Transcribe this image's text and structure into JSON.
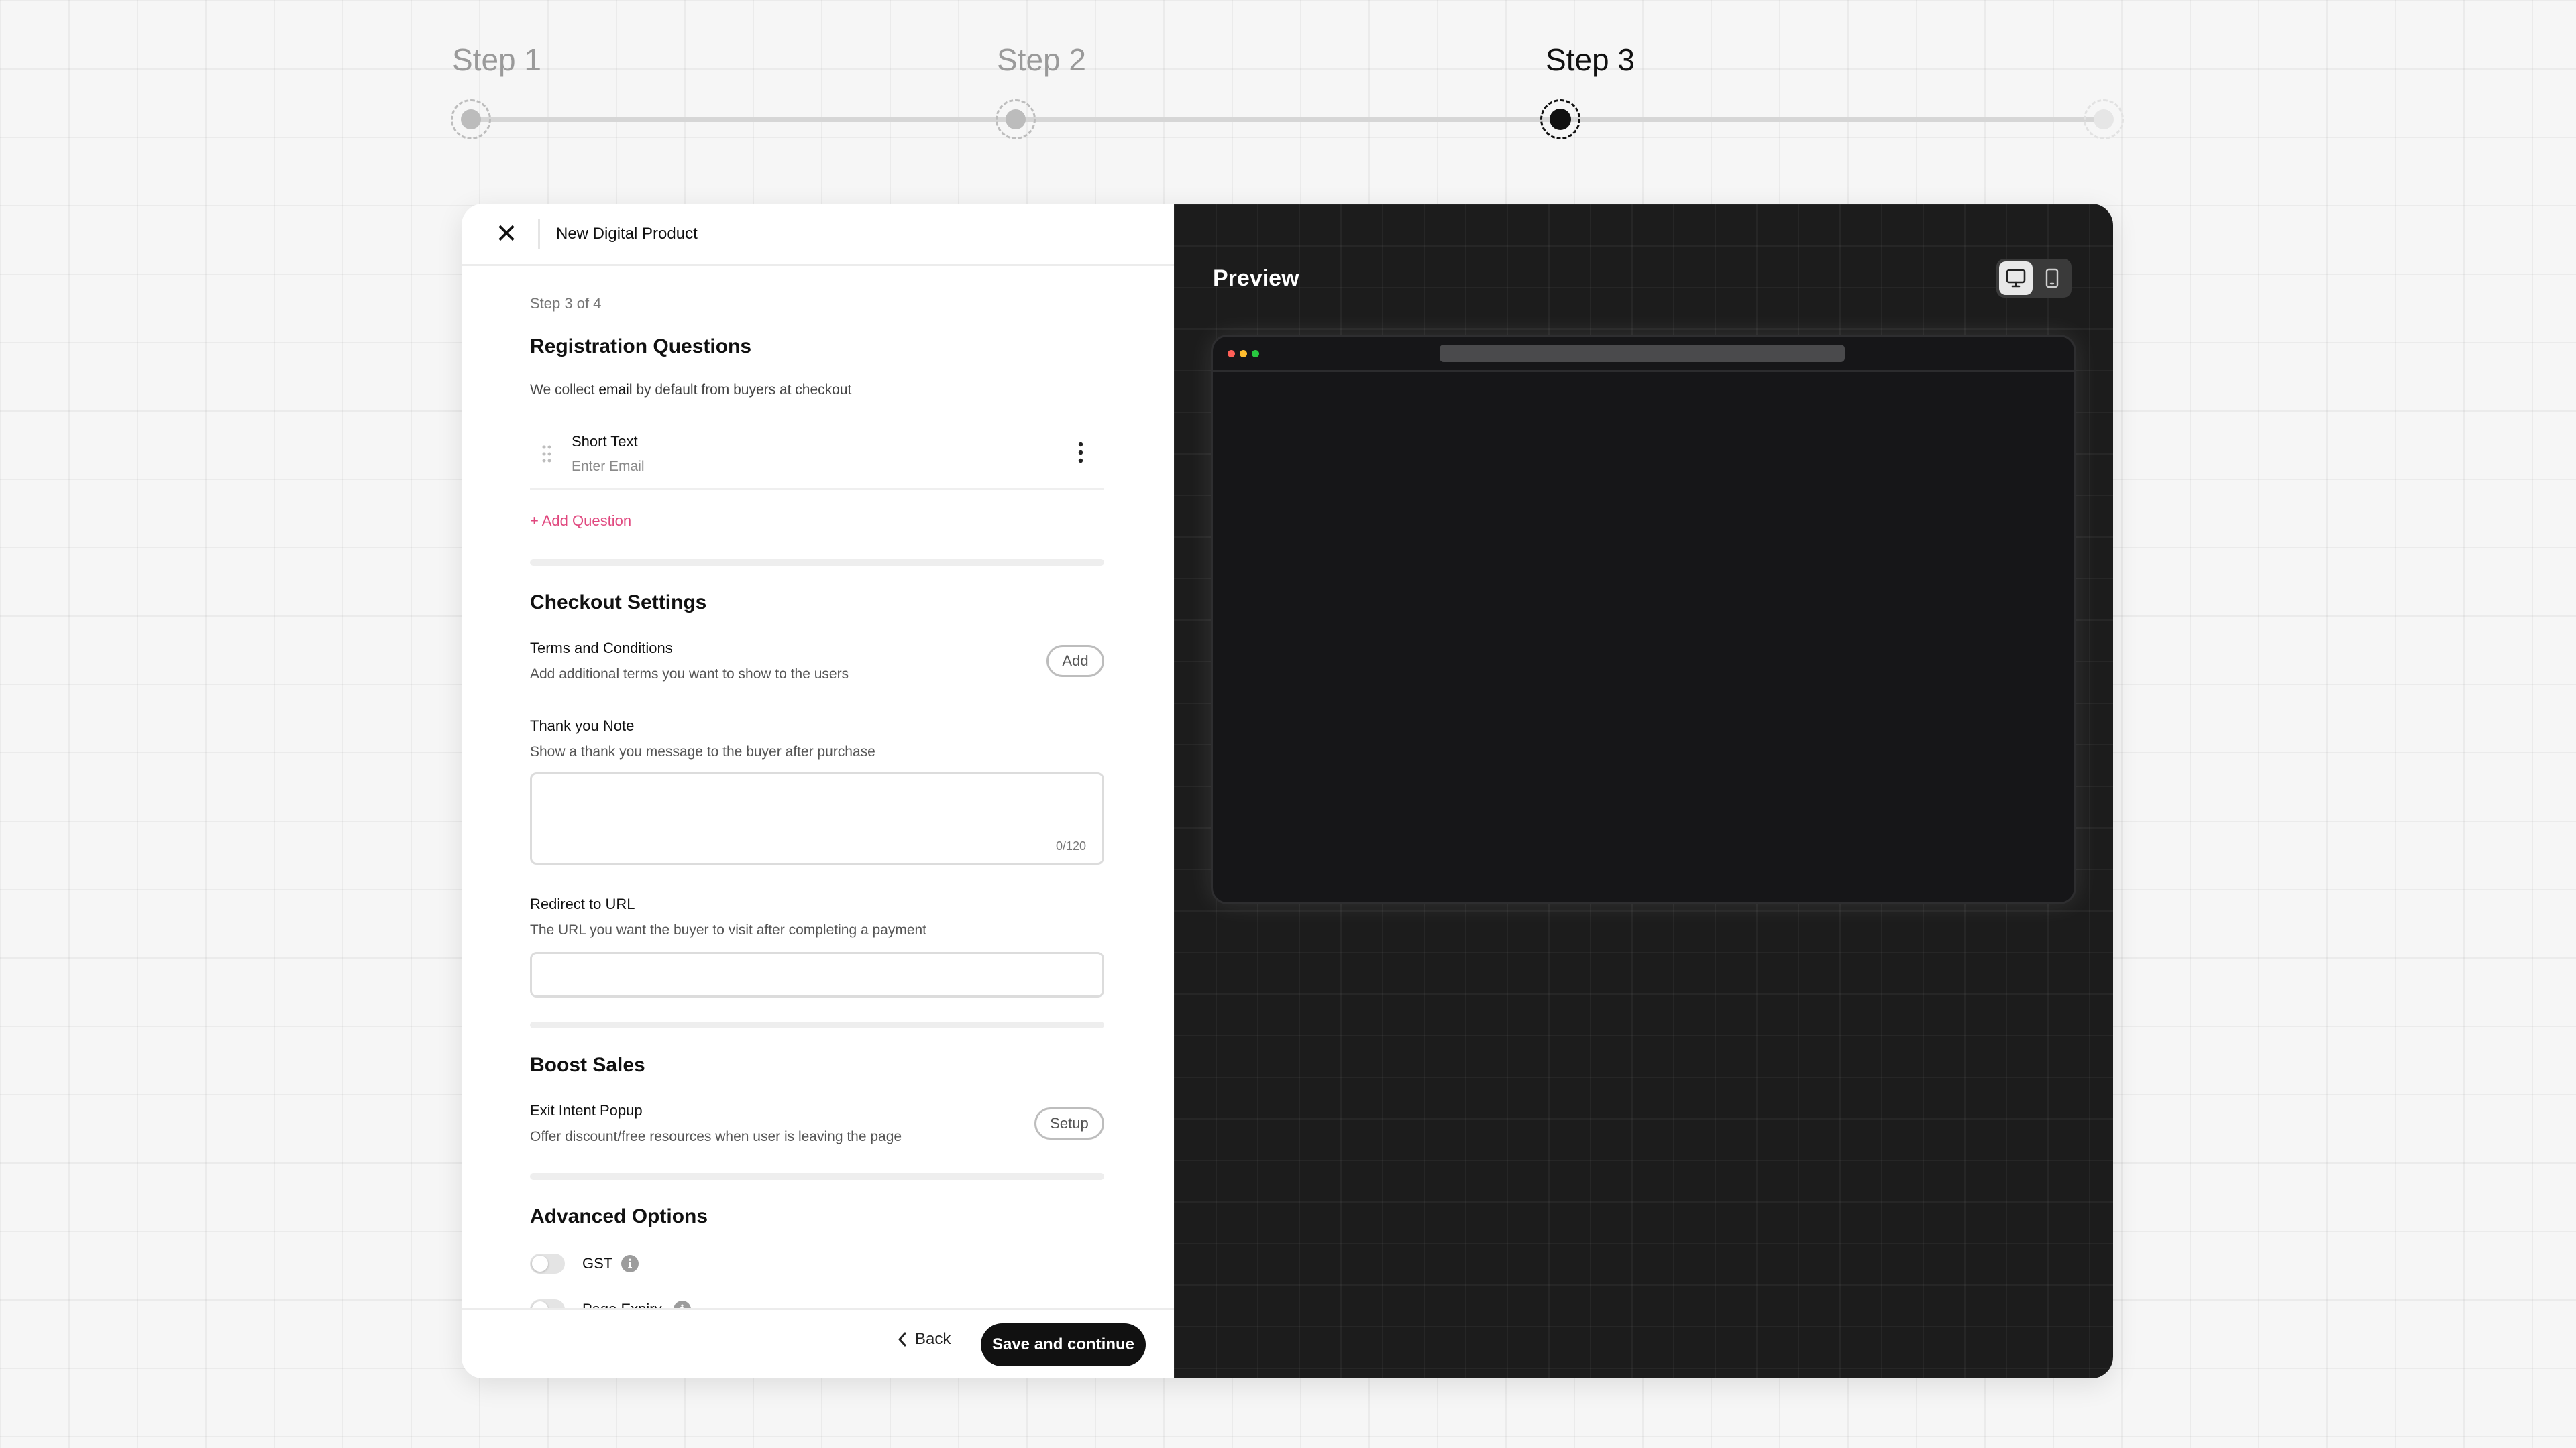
{
  "stepper": {
    "steps": [
      {
        "label": "Step 1",
        "state": "done"
      },
      {
        "label": "Step 2",
        "state": "done"
      },
      {
        "label": "Step 3",
        "state": "active"
      },
      {
        "label": "",
        "state": "future"
      }
    ]
  },
  "header": {
    "close_icon": "close-icon",
    "title": "New Digital Product"
  },
  "form": {
    "step_count": "Step 3 of 4",
    "registration": {
      "title": "Registration Questions",
      "desc_prefix": "We collect ",
      "desc_bold": "email",
      "desc_suffix": " by default from buyers at checkout",
      "question": {
        "type_label": "Short Text",
        "placeholder": "Enter Email",
        "drag_icon": "drag-handle-icon",
        "menu_icon": "more-vertical-icon"
      },
      "add_question_label": "+ Add Question",
      "accent_color": "#e0477e"
    },
    "checkout": {
      "title": "Checkout Settings",
      "terms": {
        "title": "Terms and Conditions",
        "desc": "Add additional terms you want to show to the users",
        "button": "Add"
      },
      "thank_you": {
        "title": "Thank you Note",
        "desc": "Show a thank you message to the buyer after purchase",
        "value": "",
        "counter": "0/120"
      },
      "redirect": {
        "title": "Redirect to URL",
        "desc": "The URL you want the buyer to visit after completing a payment",
        "value": ""
      }
    },
    "boost": {
      "title": "Boost Sales",
      "exit_intent": {
        "title": "Exit Intent Popup",
        "desc": "Offer discount/free resources when user is leaving the page",
        "button": "Setup"
      }
    },
    "advanced": {
      "title": "Advanced Options",
      "options": [
        {
          "label": "GST",
          "enabled": false,
          "icon": "info-icon"
        },
        {
          "label": "Page Expiry",
          "enabled": false,
          "icon": "info-icon"
        }
      ]
    }
  },
  "footer": {
    "back_label": "Back",
    "back_icon": "chevron-left-icon",
    "save_label": "Save and continue"
  },
  "preview": {
    "title": "Preview",
    "devices": [
      {
        "name": "desktop",
        "icon": "monitor-icon",
        "active": true
      },
      {
        "name": "mobile",
        "icon": "phone-icon",
        "active": false
      }
    ],
    "browser_dots": [
      "#ff5f57",
      "#febc2e",
      "#28c840"
    ]
  }
}
